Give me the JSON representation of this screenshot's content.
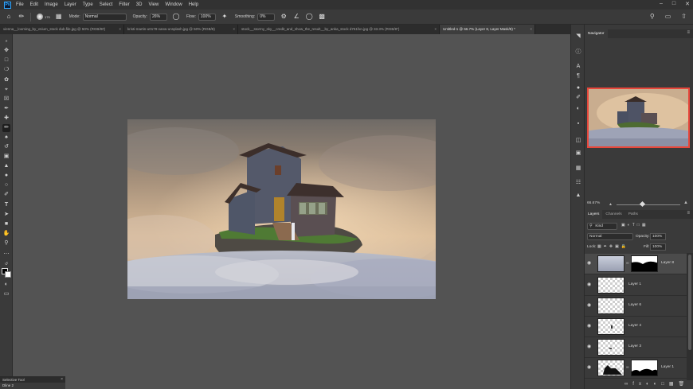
{
  "menubar": {
    "logo": "Ps",
    "items": [
      "File",
      "Edit",
      "Image",
      "Layer",
      "Type",
      "Select",
      "Filter",
      "3D",
      "View",
      "Window",
      "Help"
    ]
  },
  "options": {
    "brush_size": "175",
    "mode_label": "Mode:",
    "mode_value": "Normal",
    "opacity_label": "Opacity:",
    "opacity_value": "26%",
    "flow_label": "Flow:",
    "flow_value": "100%",
    "smoothing_label": "Smoothing:",
    "smoothing_value": "0%"
  },
  "tabs": [
    {
      "label": "vienna__looming_by_vnium_stock dub.file.jpg @ 50% (RGB/8#)"
    },
    {
      "label": "kristi-martin-u0179-vanw-unsplash.jpg @ 50% (RGB/8)"
    },
    {
      "label": "stock__stormy_sky__credit_and_show_the_result__by_anka_stock d761fxn.jpg @ 33.3% (RGB/8*)"
    },
    {
      "label": "Untitled-1 @ 66.7% (Layer 8, Layer Mask/8) *"
    }
  ],
  "navigator": {
    "tab": "Navigator",
    "zoom": "66.67%"
  },
  "layers_panel": {
    "tabs": [
      "Layers",
      "Channels",
      "Paths"
    ],
    "filter_kind": "Kind",
    "blend_mode": "Normal",
    "opacity_label": "Opacity:",
    "opacity_value": "100%",
    "lock_label": "Lock:",
    "fill_label": "Fill:",
    "fill_value": "100%",
    "layers": [
      {
        "name": "Layer 8"
      },
      {
        "name": "Layer 1"
      },
      {
        "name": "Layer 6"
      },
      {
        "name": "Layer 4"
      },
      {
        "name": "Layer 3"
      },
      {
        "name": "Layer 1"
      }
    ]
  },
  "bottom_panel": {
    "title": "Selective Tool",
    "subtitle": "Dline 2"
  },
  "colors": {
    "accent": "#31a8ff",
    "nav_frame": "#e8473b",
    "bg": "#535353"
  }
}
